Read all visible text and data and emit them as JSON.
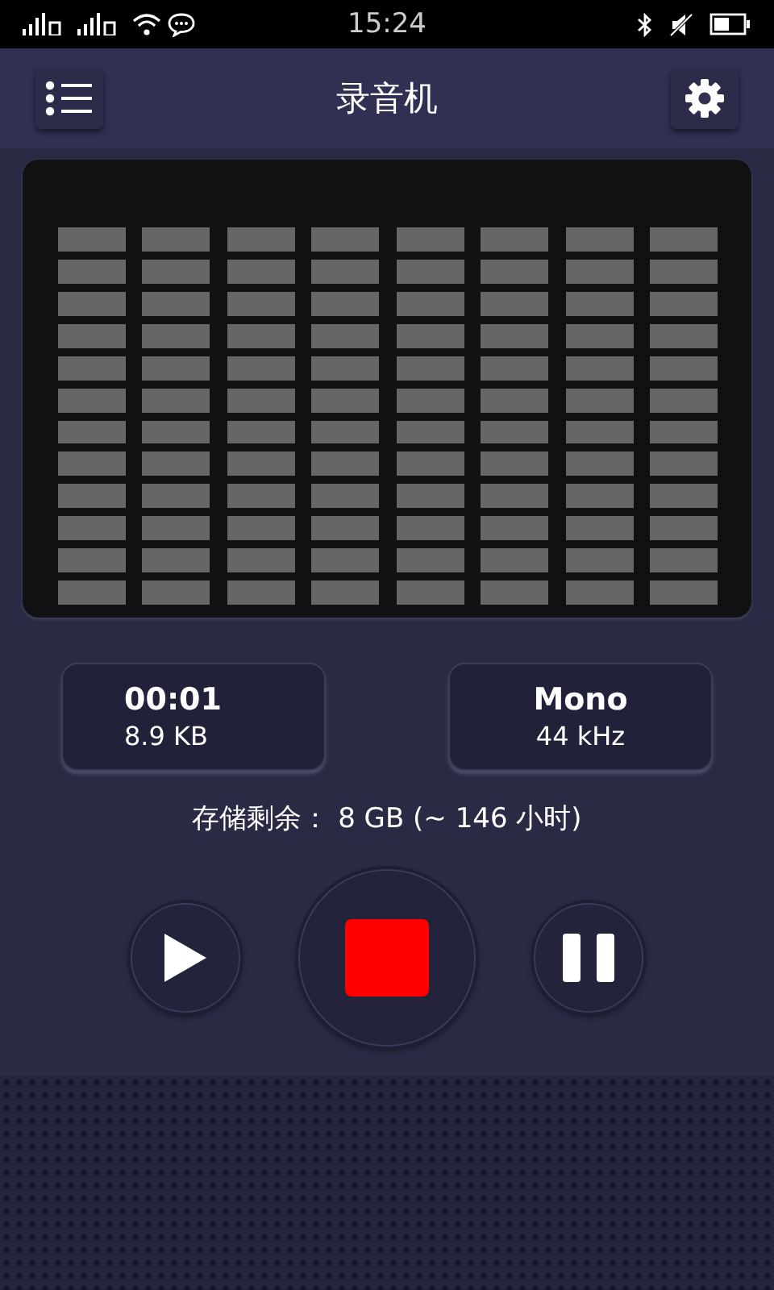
{
  "status_bar": {
    "time": "15:24"
  },
  "header": {
    "title": "录音机"
  },
  "info_cards": [
    {
      "primary": "00:01",
      "secondary": "8.9 KB"
    },
    {
      "primary": "Mono",
      "secondary": "44 kHz"
    }
  ],
  "storage": "存储剩余： 8 GB (~ 146 小时)",
  "controls": [
    {
      "kind": "play"
    },
    {
      "kind": "stop"
    },
    {
      "kind": "pause"
    }
  ]
}
